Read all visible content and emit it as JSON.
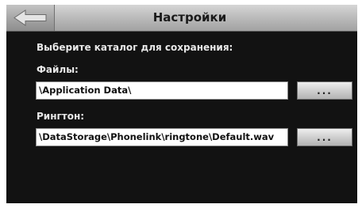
{
  "header": {
    "title": "Настройки",
    "back_icon": "back-arrow-icon"
  },
  "main": {
    "prompt": "Выберите каталог для сохранения:",
    "files": {
      "label": "Файлы:",
      "value": "\\Application Data\\",
      "browse_label": "..."
    },
    "ringtone": {
      "label": "Рингтон:",
      "value": "\\DataStorage\\Phonelink\\ringtone\\Default.wav",
      "browse_label": "..."
    }
  },
  "colors": {
    "background": "#121212",
    "text": "#e8e8e8",
    "titlebar": "#bdbdbd"
  }
}
